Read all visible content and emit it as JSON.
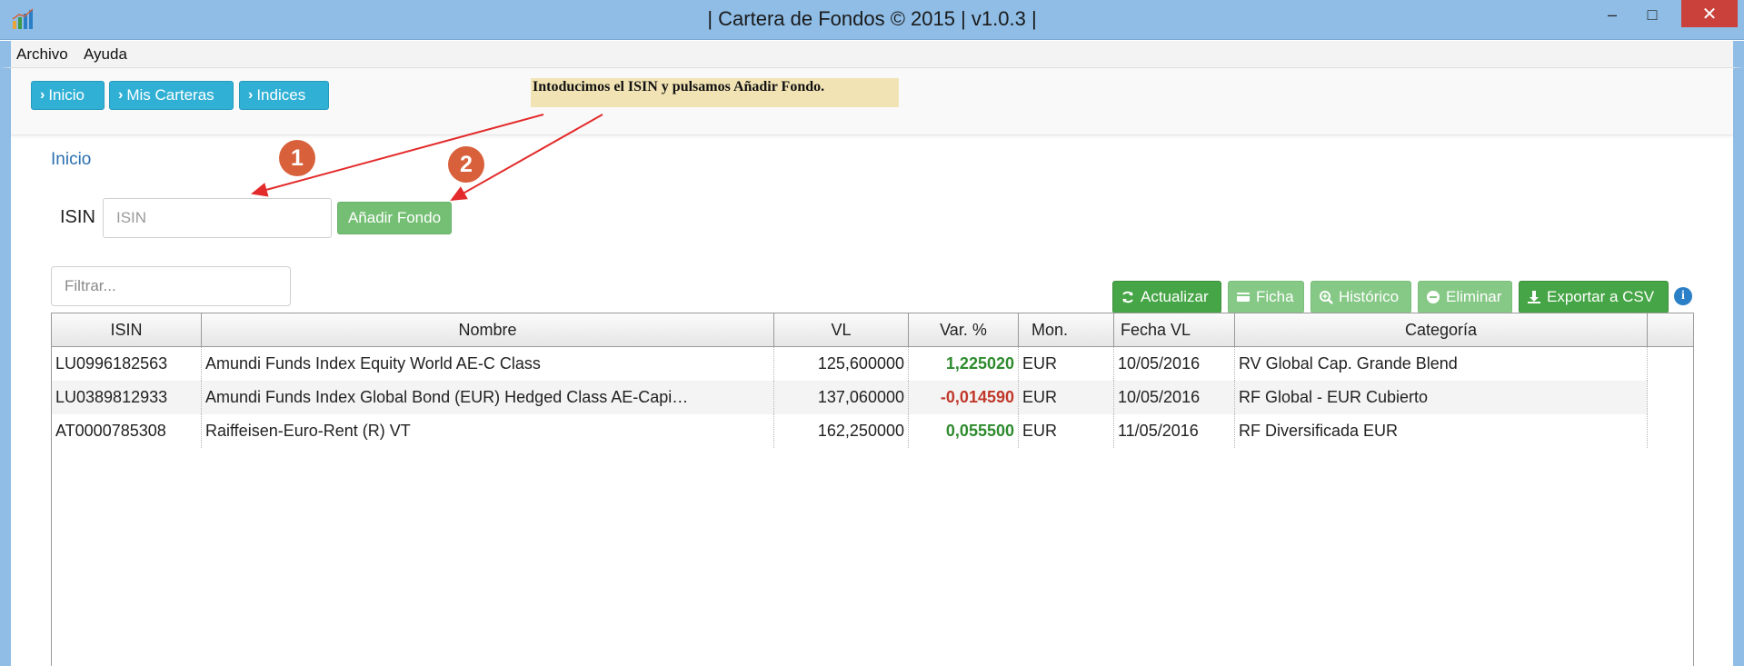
{
  "window": {
    "title": "| Cartera de Fondos © 2015 | v1.0.3 |",
    "app_icon": "chart-icon",
    "minimize": "–",
    "maximize": "□",
    "close": "✕"
  },
  "menu": {
    "items": [
      "Archivo",
      "Ayuda"
    ]
  },
  "nav": {
    "buttons": [
      {
        "label": "Inicio"
      },
      {
        "label": "Mis Carteras"
      },
      {
        "label": "Indices"
      }
    ]
  },
  "note": {
    "text": "Intoducimos el ISIN y pulsamos Añadir Fondo."
  },
  "breadcrumb": "Inicio",
  "form": {
    "isin_label": "ISIN",
    "isin_placeholder": "ISIN",
    "add_button": "Añadir Fondo"
  },
  "badges": [
    "1",
    "2"
  ],
  "filter": {
    "placeholder": "Filtrar..."
  },
  "actions": {
    "refresh": "Actualizar",
    "card": "Ficha",
    "history": "Histórico",
    "delete": "Eliminar",
    "export": "Exportar a CSV"
  },
  "table": {
    "columns": [
      "ISIN",
      "Nombre",
      "VL",
      "Var. %",
      "Mon.",
      "Fecha VL",
      "Categoría"
    ],
    "rows": [
      {
        "isin": "LU0996182563",
        "nombre": "Amundi Funds Index Equity World AE-C Class",
        "vl": "125,600000",
        "var": "1,225020",
        "var_sign": "pos",
        "mon": "EUR",
        "fecha": "10/05/2016",
        "categoria": "RV Global Cap. Grande Blend"
      },
      {
        "isin": "LU0389812933",
        "nombre": "Amundi Funds Index Global Bond (EUR) Hedged Class AE-Capi…",
        "vl": "137,060000",
        "var": "-0,014590",
        "var_sign": "neg",
        "mon": "EUR",
        "fecha": "10/05/2016",
        "categoria": "RF Global - EUR Cubierto"
      },
      {
        "isin": "AT0000785308",
        "nombre": "Raiffeisen-Euro-Rent (R) VT",
        "vl": "162,250000",
        "var": "0,055500",
        "var_sign": "pos",
        "mon": "EUR",
        "fecha": "11/05/2016",
        "categoria": "RF Diversificada EUR"
      }
    ]
  },
  "colors": {
    "titlebar": "#8fbde6",
    "nav_button": "#31b0d5",
    "success": "#46a546",
    "positive": "#2e8b2e",
    "negative": "#c0392b",
    "badge": "#d8613c",
    "arrow": "#e32b2b"
  }
}
